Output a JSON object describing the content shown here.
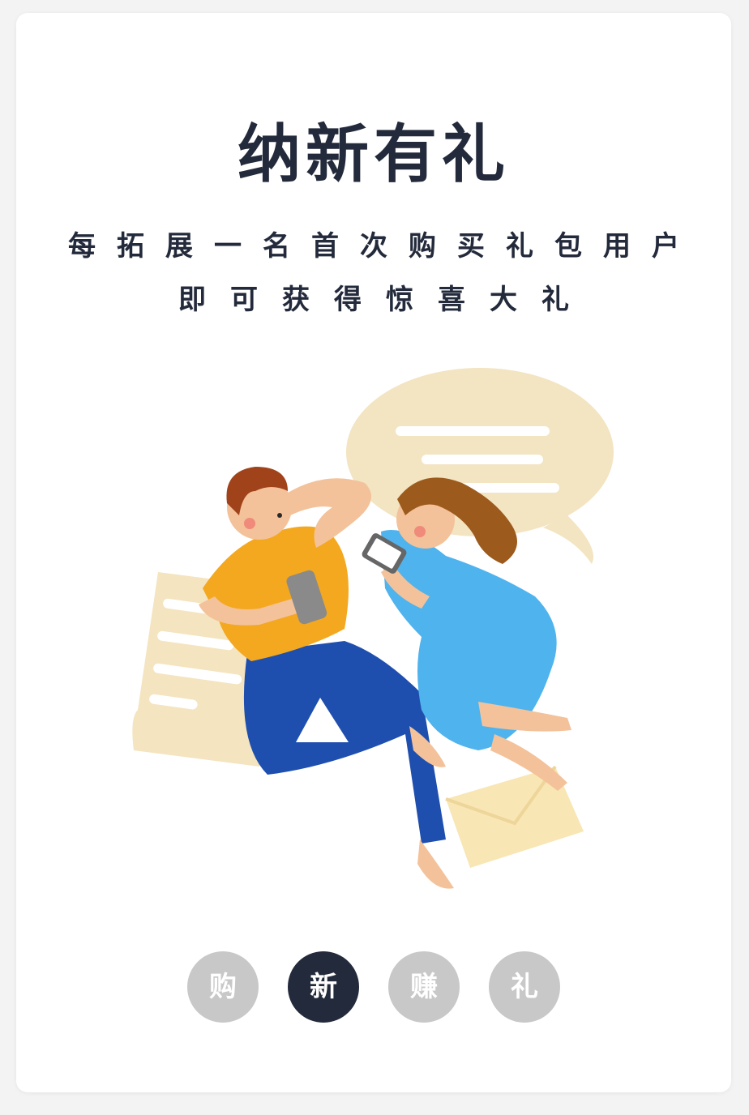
{
  "headline": {
    "title": "纳新有礼",
    "line1": "每拓展一名首次购买礼包用户",
    "line2": "即可获得惊喜大礼"
  },
  "pager": {
    "items": [
      {
        "label": "购",
        "active": false
      },
      {
        "label": "新",
        "active": true
      },
      {
        "label": "赚",
        "active": false
      },
      {
        "label": "礼",
        "active": false
      }
    ]
  },
  "colors": {
    "dark": "#232a3b",
    "inactive": "#c8c8c8",
    "shirt": "#f4a81f",
    "pants": "#1f4fae",
    "dress": "#4fb3ee",
    "paper": "#f4e4bf"
  }
}
